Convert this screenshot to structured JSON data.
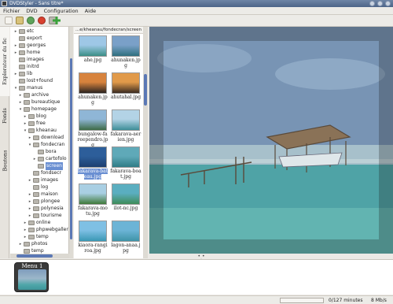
{
  "window": {
    "title": "DVDStyler - Sans titre*"
  },
  "menubar": {
    "items": [
      "Fichier",
      "DVD",
      "Configuration",
      "Aide"
    ]
  },
  "toolbar": {
    "buttons": [
      "new-icon",
      "open-icon",
      "save-icon",
      "burn-icon",
      "settings-icon",
      "add-icon"
    ]
  },
  "sidebar": {
    "tabs": [
      "Explorateur du fic",
      "Fonds",
      "Boutons"
    ]
  },
  "tree": {
    "rows": [
      {
        "label": "etc",
        "level": 1,
        "arrow": "▸"
      },
      {
        "label": "export",
        "level": 1,
        "arrow": ""
      },
      {
        "label": "georges",
        "level": 1,
        "arrow": "▸"
      },
      {
        "label": "home",
        "level": 1,
        "arrow": "▸"
      },
      {
        "label": "images",
        "level": 1,
        "arrow": ""
      },
      {
        "label": "initrd",
        "level": 1,
        "arrow": ""
      },
      {
        "label": "lib",
        "level": 1,
        "arrow": "▸"
      },
      {
        "label": "lost+found",
        "level": 1,
        "arrow": ""
      },
      {
        "label": "manus",
        "level": 1,
        "arrow": "▾"
      },
      {
        "label": "archive",
        "level": 2,
        "arrow": "▸"
      },
      {
        "label": "bureautique",
        "level": 2,
        "arrow": "▸"
      },
      {
        "label": "homepage",
        "level": 2,
        "arrow": "▾"
      },
      {
        "label": "blog",
        "level": 3,
        "arrow": "▸"
      },
      {
        "label": "free",
        "level": 3,
        "arrow": "▸"
      },
      {
        "label": "kheanau",
        "level": 3,
        "arrow": "▾"
      },
      {
        "label": "download",
        "level": 4,
        "arrow": "▸"
      },
      {
        "label": "fondecran",
        "level": 4,
        "arrow": "▾"
      },
      {
        "label": "bora",
        "level": 5,
        "arrow": ""
      },
      {
        "label": "cartofolo",
        "level": 5,
        "arrow": "▸"
      },
      {
        "label": "screen",
        "level": 5,
        "arrow": "",
        "selected": true
      },
      {
        "label": "fondsecr",
        "level": 4,
        "arrow": ""
      },
      {
        "label": "images",
        "level": 4,
        "arrow": "▸"
      },
      {
        "label": "log",
        "level": 4,
        "arrow": ""
      },
      {
        "label": "maison",
        "level": 4,
        "arrow": "▸"
      },
      {
        "label": "plongee",
        "level": 4,
        "arrow": "▸"
      },
      {
        "label": "polynesia",
        "level": 4,
        "arrow": "▸"
      },
      {
        "label": "tourisme",
        "level": 4,
        "arrow": "▸"
      },
      {
        "label": "online",
        "level": 3,
        "arrow": "▸"
      },
      {
        "label": "phpwebgaller",
        "level": 3,
        "arrow": "▸"
      },
      {
        "label": "temp",
        "level": 3,
        "arrow": "▸"
      },
      {
        "label": "photos",
        "level": 2,
        "arrow": "▸"
      },
      {
        "label": "temp",
        "level": 2,
        "arrow": ""
      }
    ]
  },
  "thumbnails": {
    "path": "...e/kheanau/fondecran/screen",
    "files": [
      {
        "name": "ahe.jpg",
        "colors": [
          "#9ec7e6",
          "#3b8f86"
        ]
      },
      {
        "name": "ahunaken.jpg",
        "colors": [
          "#7aa0c8",
          "#2f6f7f"
        ]
      },
      {
        "name": "ahunaken.jpg",
        "colors": [
          "#d7833d",
          "#2a2320"
        ]
      },
      {
        "name": "ahutahal.jpg",
        "colors": [
          "#e19a4a",
          "#3a2b20"
        ]
      },
      {
        "name": "bungalow-fareependro.jpg",
        "colors": [
          "#8fb6d6",
          "#3d6b45"
        ]
      },
      {
        "name": "fakarava-aerien.jpg",
        "colors": [
          "#b3d3e6",
          "#3d8e98"
        ]
      },
      {
        "name": "fakarava-bateau.jpg",
        "colors": [
          "#2d5e9a",
          "#1c3f70"
        ],
        "selected": true
      },
      {
        "name": "fakarava-boat.jpg",
        "colors": [
          "#5fa9b8",
          "#2f7c86"
        ]
      },
      {
        "name": "fakarava-motu.jpg",
        "colors": [
          "#a9cfe3",
          "#3f7a3a"
        ]
      },
      {
        "name": "ilot-nc.jpg",
        "colors": [
          "#5aaec0",
          "#3f8c59"
        ]
      },
      {
        "name": "kiaora-rangiroa.jpg",
        "colors": [
          "#7fc0e4",
          "#3a97b4"
        ]
      },
      {
        "name": "lagon-anaa.jpg",
        "colors": [
          "#6cb4d6",
          "#3e93a7"
        ]
      }
    ]
  },
  "menus": {
    "items": [
      {
        "label": "Menu 1"
      }
    ]
  },
  "status": {
    "progress_fraction": 0.0,
    "duration": "0/127 minutes",
    "bitrate": "8 Mb/s"
  }
}
